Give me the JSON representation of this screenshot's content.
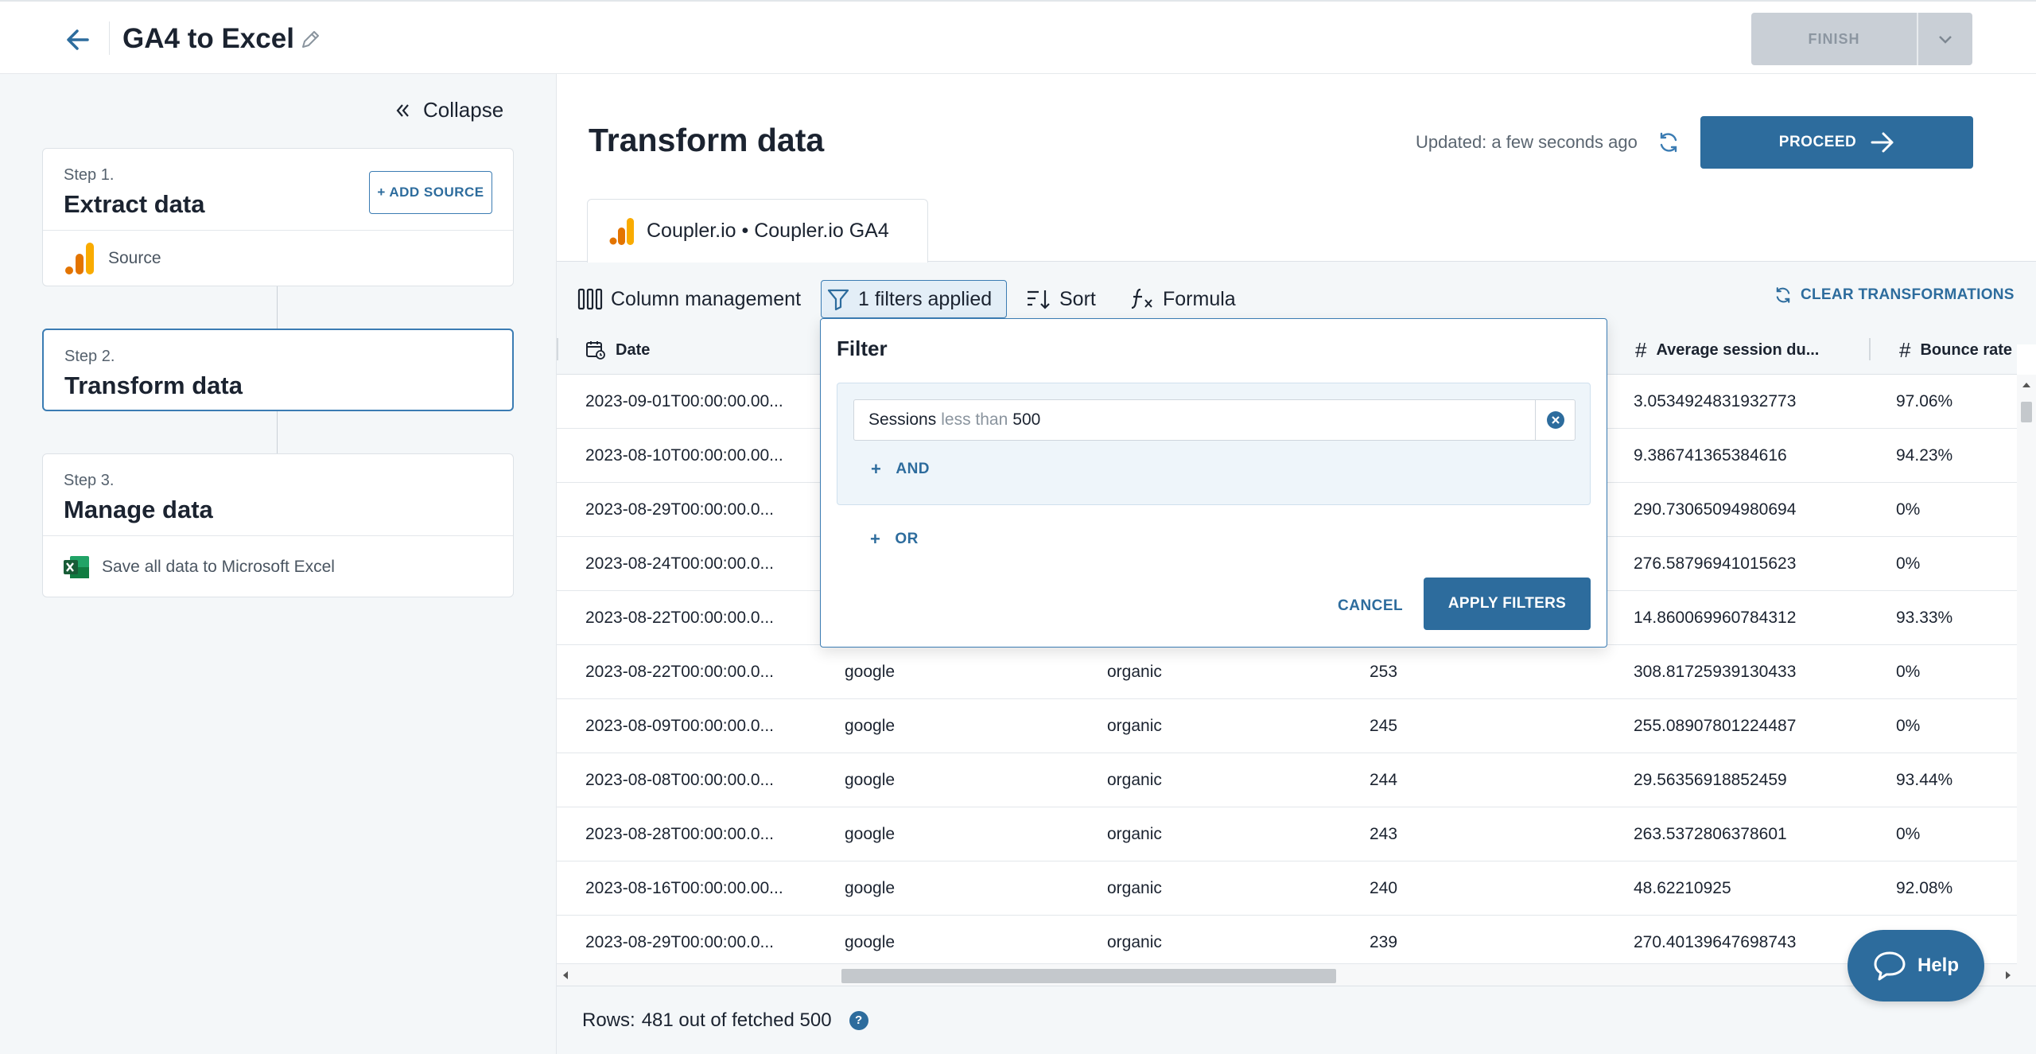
{
  "header": {
    "title": "GA4 to Excel",
    "finish_label": "FINISH"
  },
  "sidebar": {
    "collapse_label": "Collapse",
    "steps": [
      {
        "label": "Step 1.",
        "title": "Extract data",
        "add_source_label": "+ ADD SOURCE",
        "row_label": "Source"
      },
      {
        "label": "Step 2.",
        "title": "Transform data"
      },
      {
        "label": "Step 3.",
        "title": "Manage data",
        "row_label": "Save all data to Microsoft Excel"
      }
    ]
  },
  "main": {
    "title": "Transform data",
    "updated": "Updated: a few seconds ago",
    "proceed_label": "PROCEED",
    "source_tab": "Coupler.io • Coupler.io GA4",
    "toolbar": {
      "columns": "Column management",
      "filters": "1 filters applied",
      "sort": "Sort",
      "formula": "Formula",
      "clear": "CLEAR TRANSFORMATIONS"
    },
    "columns": [
      "Date",
      "Average session du...",
      "Bounce rate"
    ],
    "rows": [
      [
        "2023-09-01T00:00:00.00...",
        "",
        "",
        "",
        "3.0534924831932773",
        "97.06%"
      ],
      [
        "2023-08-10T00:00:00.00...",
        "",
        "",
        "",
        "9.386741365384616",
        "94.23%"
      ],
      [
        "2023-08-29T00:00:00.0...",
        "",
        "",
        "",
        "290.73065094980694",
        "0%"
      ],
      [
        "2023-08-24T00:00:00.0...",
        "",
        "",
        "",
        "276.58796941015623",
        "0%"
      ],
      [
        "2023-08-22T00:00:00.0...",
        "",
        "",
        "",
        "14.860069960784312",
        "93.33%"
      ],
      [
        "2023-08-22T00:00:00.0...",
        "google",
        "organic",
        "253",
        "308.81725939130433",
        "0%"
      ],
      [
        "2023-08-09T00:00:00.0...",
        "google",
        "organic",
        "245",
        "255.08907801224487",
        "0%"
      ],
      [
        "2023-08-08T00:00:00.0...",
        "google",
        "organic",
        "244",
        "29.56356918852459",
        "93.44%"
      ],
      [
        "2023-08-28T00:00:00.0...",
        "google",
        "organic",
        "243",
        "263.5372806378601",
        "0%"
      ],
      [
        "2023-08-16T00:00:00.00...",
        "google",
        "organic",
        "240",
        "48.62210925",
        "92.08%"
      ],
      [
        "2023-08-29T00:00:00.0...",
        "google",
        "organic",
        "239",
        "270.40139647698743",
        ""
      ]
    ],
    "footer": {
      "rows_label": "Rows:",
      "rows_value": "481 out of fetched 500",
      "help": "?"
    }
  },
  "filter": {
    "title": "Filter",
    "condition": {
      "field": "Sessions",
      "operator": "less than",
      "value": "500"
    },
    "and_label": "AND",
    "or_label": "OR",
    "cancel_label": "CANCEL",
    "apply_label": "APPLY FILTERS"
  },
  "help_fab": "Help",
  "colors": {
    "primary": "#2d6c9d",
    "accent_border": "#3b7cb3",
    "panel_bg": "#f4f7f9"
  }
}
